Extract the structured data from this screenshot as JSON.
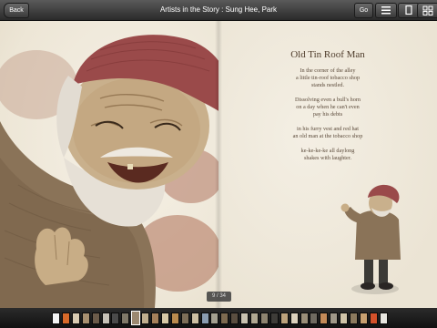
{
  "toolbar": {
    "back_label": "Back",
    "title": "Artists in the Story : Sung Hee, Park",
    "go_label": "Go"
  },
  "poem": {
    "title": "Old Tin Roof Man",
    "stanzas": [
      [
        "In the corner of the alley",
        "a little tin-roof tobacco shop",
        "stands nestled."
      ],
      [
        "Dissolving even a bull's horn",
        "on a day when he can't even",
        "pay his debts"
      ],
      [
        "in his furry vest and red hat",
        "an old man at the tobacco shop"
      ],
      [
        "ke-ke-ke-ke all daylong",
        "shakes with laughter."
      ]
    ]
  },
  "page_indicator": "9 / 34",
  "colors": {
    "hat": "#9a4a4a",
    "sweater": "#8a7358",
    "skin": "#c9b08c",
    "paint_blot": "#b07a62",
    "page": "#f1ece2"
  },
  "thumbnails": [
    {
      "color": "#f4f4f4"
    },
    {
      "color": "#d86a2a"
    },
    {
      "color": "#d9cbb2"
    },
    {
      "color": "#a89070"
    },
    {
      "color": "#6b5b4a"
    },
    {
      "color": "#c7c2b8"
    },
    {
      "color": "#4a4a4a"
    },
    {
      "color": "#7f7868"
    },
    {
      "color": "#9b8870",
      "active": true
    },
    {
      "color": "#bfae8e"
    },
    {
      "color": "#a5805a"
    },
    {
      "color": "#d8c9a6"
    },
    {
      "color": "#b98a4e"
    },
    {
      "color": "#7d6e58"
    },
    {
      "color": "#cdbfa2"
    },
    {
      "color": "#8a9cb0"
    },
    {
      "color": "#a4a090"
    },
    {
      "color": "#7d6a50"
    },
    {
      "color": "#5a4e40"
    },
    {
      "color": "#c9c2b0"
    },
    {
      "color": "#b0a892"
    },
    {
      "color": "#8e8470"
    },
    {
      "color": "#3e3c38"
    },
    {
      "color": "#bca27c"
    },
    {
      "color": "#dcd2bd"
    },
    {
      "color": "#9a8e78"
    },
    {
      "color": "#6f6a60"
    },
    {
      "color": "#c48a58"
    },
    {
      "color": "#a09888"
    },
    {
      "color": "#d0c4a8"
    },
    {
      "color": "#8c7a5e"
    },
    {
      "color": "#c8a070"
    },
    {
      "color": "#d4512a"
    },
    {
      "color": "#e8e6e0"
    }
  ]
}
